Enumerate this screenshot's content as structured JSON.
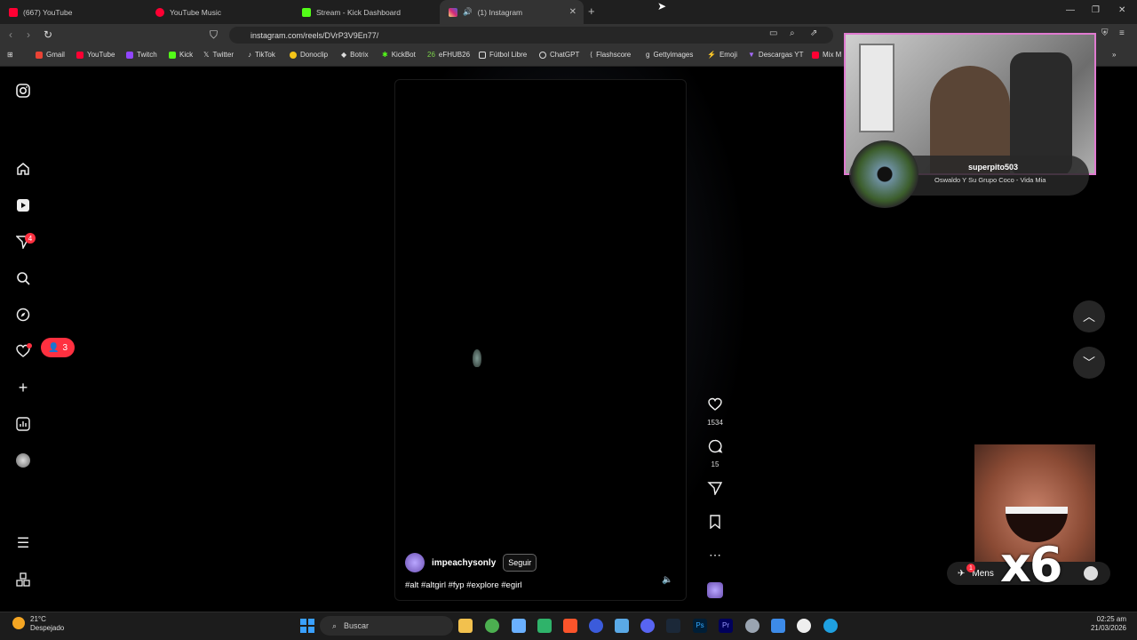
{
  "tabs": [
    {
      "title": "(667) YouTube",
      "color": "#ff0033"
    },
    {
      "title": "YouTube Music",
      "color": "#ff0033"
    },
    {
      "title": "Stream - Kick Dashboard",
      "color": "#53fc18"
    },
    {
      "title": "(1) Instagram",
      "color": "#e1306c"
    }
  ],
  "address": {
    "url": "instagram.com/reels/DVrP3V9En77/"
  },
  "bookmarks": [
    {
      "label": "Gmail",
      "color": "#ea4335"
    },
    {
      "label": "YouTube",
      "color": "#ff0033"
    },
    {
      "label": "Twitch",
      "color": "#9146ff"
    },
    {
      "label": "Kick",
      "color": "#53fc18"
    },
    {
      "label": "Twitter",
      "color": "#ffffff"
    },
    {
      "label": "TikTok",
      "color": "#25f4ee"
    },
    {
      "label": "Donoclip",
      "color": "#f5c518"
    },
    {
      "label": "Botrix",
      "color": "#cccccc"
    },
    {
      "label": "KickBot",
      "color": "#53fc18"
    },
    {
      "label": "eFHUB26",
      "color": "#7cd34a"
    },
    {
      "label": "Fútbol Libre",
      "color": "#dddddd"
    },
    {
      "label": "ChatGPT",
      "color": "#dddddd"
    },
    {
      "label": "Flashscore",
      "color": "#dddddd"
    },
    {
      "label": "Gettyimages",
      "color": "#dddddd"
    },
    {
      "label": "Emoji",
      "color": "#ff3040"
    },
    {
      "label": "Descargas YT",
      "color": "#a66bff"
    },
    {
      "label": "Mix M",
      "color": "#ff0033"
    }
  ],
  "sidebar": {
    "notifications_badge": "4",
    "activity_badge": "3"
  },
  "reel": {
    "likes": "1534",
    "comments": "15",
    "username": "impeachysonly",
    "follow_label": "Seguir",
    "caption": "#alt #altgirl #fyp #explore #egirl"
  },
  "overlay": {
    "streamer": "superpito503",
    "song": "Oswaldo Y Su Grupo Coco - Vida Mia",
    "meme_text": "x6",
    "messages_label": "Mens",
    "messages_badge": "1"
  },
  "taskbar": {
    "temperature": "21°C",
    "condition": "Despejado",
    "search_placeholder": "Buscar",
    "time": "02:25 am",
    "date": "21/03/2026"
  }
}
